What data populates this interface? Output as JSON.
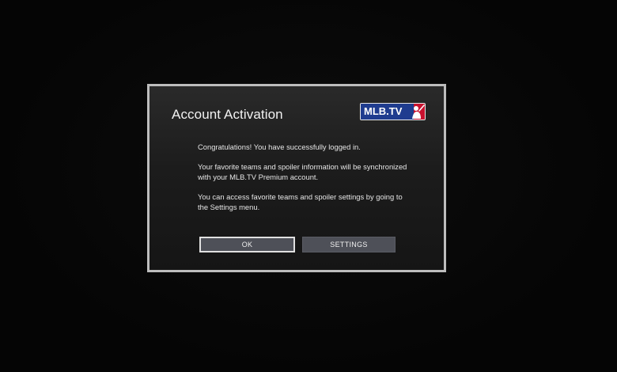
{
  "dialog": {
    "title": "Account Activation",
    "logo": {
      "text": "MLB.TV",
      "icon": "mlb-batter-logo-icon",
      "colors": {
        "blue": "#1f3c8f",
        "red": "#c8102e",
        "border": "#e8e8e8"
      }
    },
    "messages": [
      "Congratulations! You have successfully logged in.",
      "Your favorite teams and spoiler information will be synchronized with your MLB.TV Premium account.",
      "You can access favorite teams and spoiler settings by going to the Settings menu."
    ],
    "buttons": {
      "ok_label": "OK",
      "settings_label": "SETTINGS",
      "focused": "OK"
    },
    "colors": {
      "border": "#bdbdbd",
      "button_bg": "#4e5058",
      "focus_border": "#e0e0e0"
    }
  }
}
